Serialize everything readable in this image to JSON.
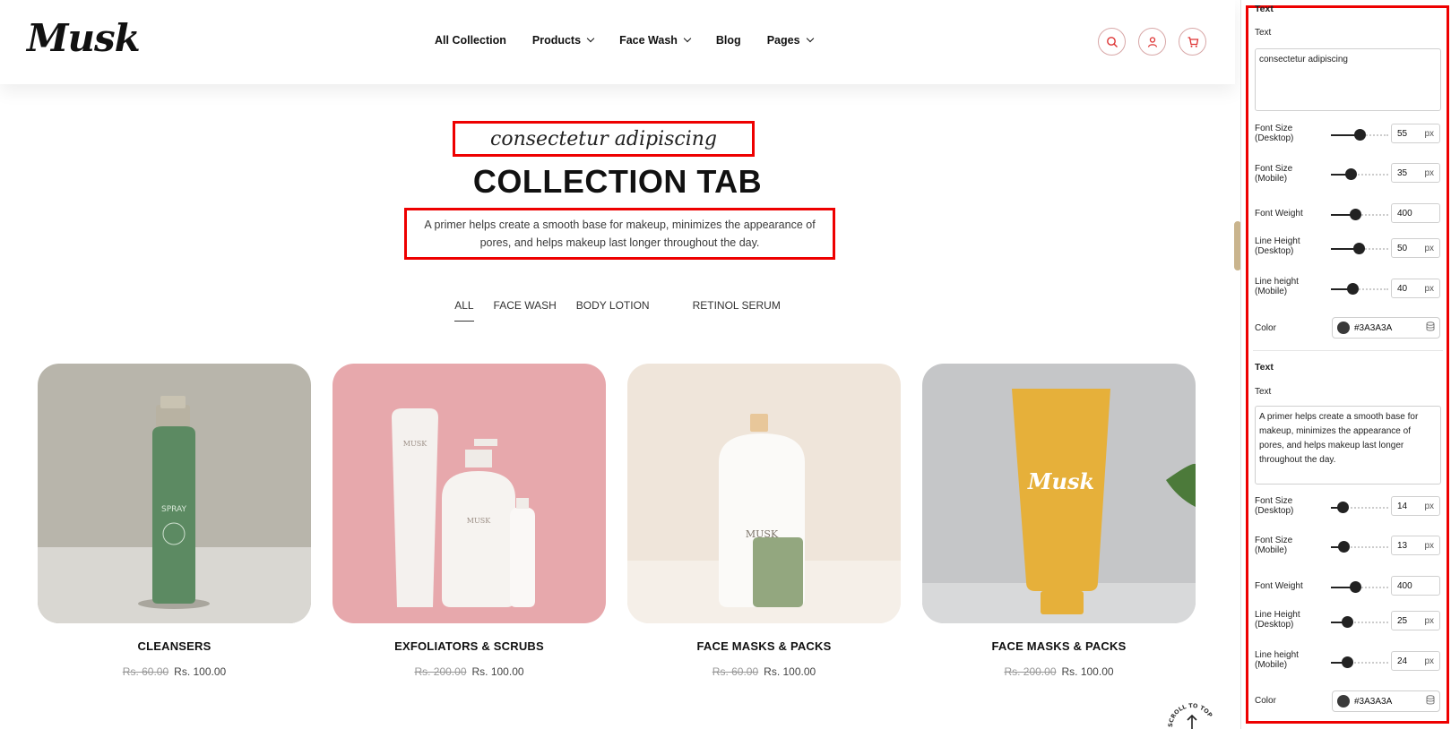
{
  "header": {
    "logo": "Musk",
    "nav": [
      {
        "label": "All Collection",
        "has_dropdown": false
      },
      {
        "label": "Products",
        "has_dropdown": true
      },
      {
        "label": "Face Wash",
        "has_dropdown": true
      },
      {
        "label": "Blog",
        "has_dropdown": false
      },
      {
        "label": "Pages",
        "has_dropdown": true
      }
    ],
    "icons": [
      "search-icon",
      "user-icon",
      "cart-icon"
    ]
  },
  "hero": {
    "tagline": "consectetur adipiscing",
    "title": "COLLECTION TAB",
    "description": "A primer helps create a smooth base for makeup, minimizes the appearance of pores, and helps makeup last longer throughout the day."
  },
  "tabs": [
    "ALL",
    "FACE WASH",
    "BODY LOTION",
    "RETINOL SERUM"
  ],
  "products": [
    {
      "name": "CLEANSERS",
      "old_price": "Rs. 60.00",
      "price": "Rs. 100.00",
      "bg": "#b9b6ad",
      "label": "SPRAY"
    },
    {
      "name": "EXFOLIATORS & SCRUBS",
      "old_price": "Rs. 200.00",
      "price": "Rs. 100.00",
      "bg": "#e8a9ad",
      "label": "MUSK"
    },
    {
      "name": "FACE MASKS & PACKS",
      "old_price": "Rs. 60.00",
      "price": "Rs. 100.00",
      "bg": "#efe5db",
      "label": "MUSK"
    },
    {
      "name": "FACE MASKS & PACKS",
      "old_price": "Rs. 200.00",
      "price": "Rs. 100.00",
      "bg": "#c6c7c9",
      "label": "Musk"
    }
  ],
  "scroll_to_top": "SCROLL TO TOP",
  "panel": {
    "section1": {
      "heading": "Text",
      "text_label": "Text",
      "text_value": "consectetur adipiscing",
      "font_size_desktop_label": "Font Size (Desktop)",
      "font_size_desktop": "55",
      "font_size_mobile_label": "Font Size (Mobile)",
      "font_size_mobile": "35",
      "font_weight_label": "Font Weight",
      "font_weight": "400",
      "line_height_desktop_label": "Line Height (Desktop)",
      "line_height_desktop": "50",
      "line_height_mobile_label": "Line height (Mobile)",
      "line_height_mobile": "40",
      "color_label": "Color",
      "color": "#3A3A3A"
    },
    "section2": {
      "heading": "Text",
      "text_label": "Text",
      "text_value": "A primer helps create a smooth base for makeup, minimizes the appearance of pores, and helps makeup last longer throughout the day.",
      "font_size_desktop_label": "Font Size (Desktop)",
      "font_size_desktop": "14",
      "font_size_mobile_label": "Font Size (Mobile)",
      "font_size_mobile": "13",
      "font_weight_label": "Font Weight",
      "font_weight": "400",
      "line_height_desktop_label": "Line Height (Desktop)",
      "line_height_desktop": "25",
      "line_height_mobile_label": "Line height (Mobile)",
      "line_height_mobile": "24",
      "color_label": "Color",
      "color": "#3A3A3A"
    },
    "unit": "px",
    "slider_levels": {
      "s1": [
        0.5,
        0.35,
        0.42,
        0.48,
        0.38
      ],
      "s2": [
        0.2,
        0.22,
        0.42,
        0.28,
        0.28
      ]
    }
  }
}
